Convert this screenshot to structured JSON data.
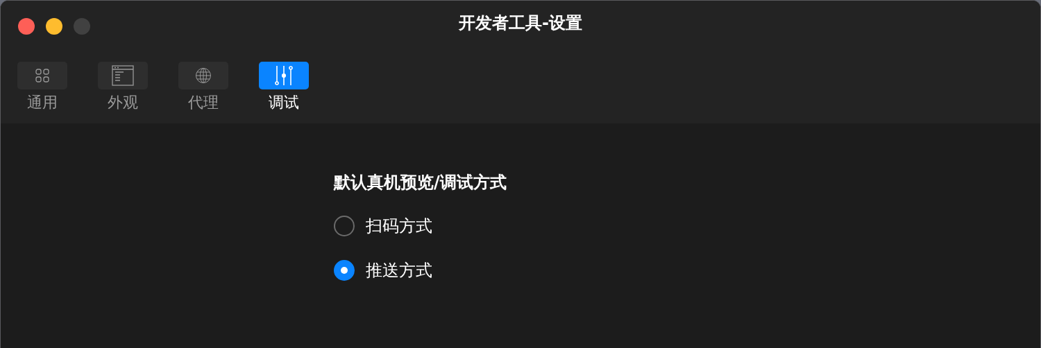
{
  "window": {
    "title": "开发者工具-设置"
  },
  "tabs": [
    {
      "label": "通用",
      "kind": "grid",
      "selected": false
    },
    {
      "label": "外观",
      "kind": "window",
      "selected": false
    },
    {
      "label": "代理",
      "kind": "globe",
      "selected": false
    },
    {
      "label": "调试",
      "kind": "sliders",
      "selected": true
    }
  ],
  "section": {
    "title": "默认真机预览/调试方式",
    "options": [
      {
        "label": "扫码方式",
        "selected": false
      },
      {
        "label": "推送方式",
        "selected": true
      }
    ]
  }
}
